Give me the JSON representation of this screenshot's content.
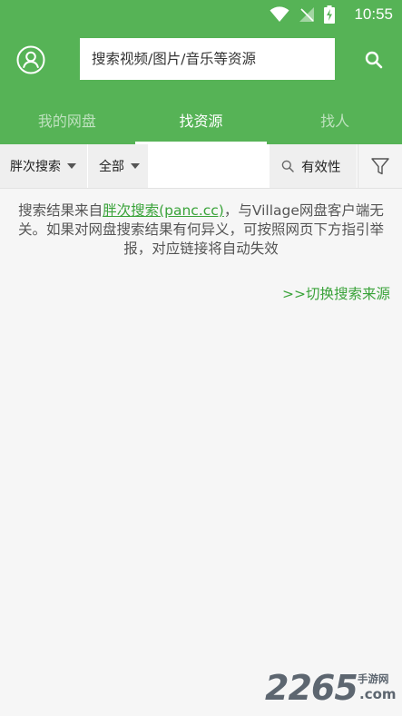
{
  "status_bar": {
    "time": "10:55",
    "icons": [
      "wifi-icon",
      "no-signal-icon",
      "battery-charging-icon"
    ]
  },
  "header": {
    "avatar_icon": "user-circle-icon",
    "search": {
      "placeholder": "搜索视频/图片/音乐等资源"
    },
    "search_icon": "search-icon",
    "tabs": [
      {
        "label": "我的网盘",
        "active": false
      },
      {
        "label": "找资源",
        "active": true
      },
      {
        "label": "找人",
        "active": false
      }
    ]
  },
  "filter_bar": {
    "source_dropdown": {
      "label": "胖次搜索"
    },
    "type_dropdown": {
      "label": "全部"
    },
    "validity_label": "有效性",
    "filter_icon": "funnel-icon"
  },
  "notice": {
    "text_before": "搜索结果来自",
    "link_text": "胖次搜索(panc.cc)",
    "text_after": "，与Village网盘客户端无关。如果对网盘搜索结果有何异义，可按照网页下方指引举报，对应链接将自动失效"
  },
  "switch_source_label": ">>切换搜索来源",
  "watermark": {
    "number": "2265",
    "cn": "手游网",
    "suffix": ".com"
  },
  "colors": {
    "brand_green": "#56b356",
    "link_green": "#3aa33a",
    "background": "#f6f6f6"
  }
}
